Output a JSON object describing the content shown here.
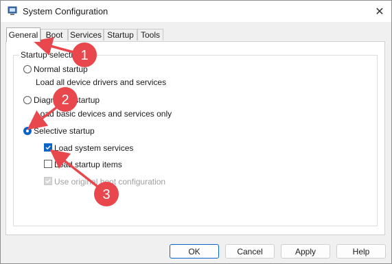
{
  "window": {
    "title": "System Configuration",
    "close_glyph": "✕",
    "app_icon": "system-config-icon"
  },
  "tabs": [
    {
      "label": "General",
      "active": true
    },
    {
      "label": "Boot",
      "active": false
    },
    {
      "label": "Services",
      "active": false
    },
    {
      "label": "Startup",
      "active": false
    },
    {
      "label": "Tools",
      "active": false
    }
  ],
  "general": {
    "group_label": "Startup selection",
    "normal": {
      "label": "Normal startup",
      "description": "Load all device drivers and services",
      "selected": false
    },
    "diagnostic": {
      "label": "Diagnostic startup",
      "description": "Load basic devices and services only",
      "selected": false
    },
    "selective": {
      "label": "Selective startup",
      "selected": true
    },
    "options": [
      {
        "label": "Load system services",
        "checked": true,
        "enabled": true
      },
      {
        "label": "Load startup items",
        "checked": false,
        "enabled": true
      },
      {
        "label": "Use original boot configuration",
        "checked": true,
        "enabled": false
      }
    ]
  },
  "buttons": {
    "ok": "OK",
    "cancel": "Cancel",
    "apply": "Apply",
    "help": "Help"
  },
  "annotations": {
    "color": "#e8474d",
    "steps": [
      "1",
      "2",
      "3"
    ]
  }
}
